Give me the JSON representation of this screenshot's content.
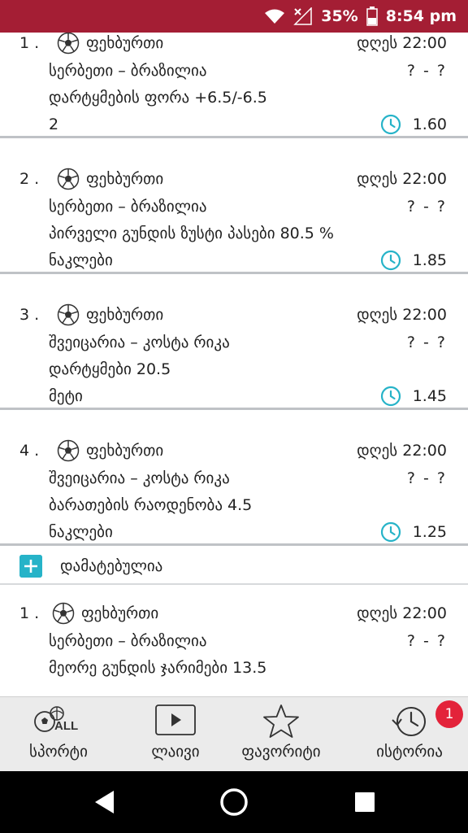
{
  "status_bar": {
    "battery": "35%",
    "time": "8:54 pm"
  },
  "bets": [
    {
      "number": "1 .",
      "sport": "ფეხბურთი",
      "when": "დღეს 22:00",
      "teams": "სერბეთი – ბრაზილია",
      "score": "? - ?",
      "market": "დარტყმების ფორა +6.5/-6.5",
      "pick": "2",
      "odds": "1.60"
    },
    {
      "number": "2 .",
      "sport": "ფეხბურთი",
      "when": "დღეს 22:00",
      "teams": "სერბეთი – ბრაზილია",
      "score": "? - ?",
      "market": "პირველი გუნდის ზუსტი პასები 80.5 %",
      "pick": "ნაკლები",
      "odds": "1.85"
    },
    {
      "number": "3 .",
      "sport": "ფეხბურთი",
      "when": "დღეს 22:00",
      "teams": "შვეიცარია – კოსტა რიკა",
      "score": "? - ?",
      "market": "დარტყმები 20.5",
      "pick": "მეტი",
      "odds": "1.45"
    },
    {
      "number": "4 .",
      "sport": "ფეხბურთი",
      "when": "დღეს 22:00",
      "teams": "შვეიცარია – კოსტა რიკა",
      "score": "? - ?",
      "market": "ბარათების რაოდენობა 4.5",
      "pick": "ნაკლები",
      "odds": "1.25"
    }
  ],
  "added_label": "დამატებულია",
  "added_bets": [
    {
      "number": "1 .",
      "sport": "ფეხბურთი",
      "when": "დღეს 22:00",
      "teams": "სერბეთი – ბრაზილია",
      "score": "? - ?",
      "market": "მეორე გუნდის ჯარიმები 13.5",
      "pick": "",
      "odds": ""
    }
  ],
  "bottom_nav": [
    {
      "label": "სპორტი",
      "icon": "sports-all-icon",
      "icon_text": "ALL"
    },
    {
      "label": "ლაივი",
      "icon": "live-play-icon"
    },
    {
      "label": "ფავორიტი",
      "icon": "star-icon"
    },
    {
      "label": "ისტორია",
      "icon": "history-icon",
      "badge": "1"
    }
  ],
  "colors": {
    "status_bar": "#a41e34",
    "accent": "#26b3c8",
    "badge": "#e3233a"
  }
}
